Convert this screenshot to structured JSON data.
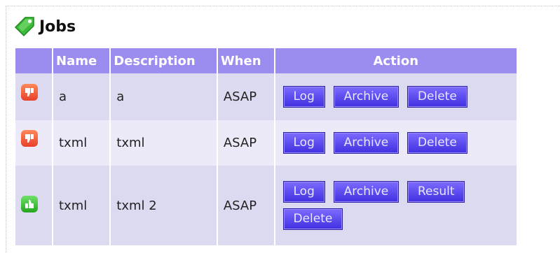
{
  "section": {
    "title": "Jobs"
  },
  "table": {
    "headers": {
      "name": "Name",
      "description": "Description",
      "when": "When",
      "action": "Action"
    },
    "rows": [
      {
        "status": "thumbs-down-icon",
        "name": "a",
        "description": "a",
        "when": "ASAP",
        "buttons": {
          "log": "Log",
          "archive": "Archive",
          "delete": "Delete"
        }
      },
      {
        "status": "thumbs-down-icon",
        "name": "txml",
        "description": "txml",
        "when": "ASAP",
        "buttons": {
          "log": "Log",
          "archive": "Archive",
          "delete": "Delete"
        }
      },
      {
        "status": "thumbs-up-icon",
        "name": "txml",
        "description": "txml 2",
        "when": "ASAP",
        "buttons": {
          "log": "Log",
          "archive": "Archive",
          "result": "Result",
          "delete": "Delete"
        }
      }
    ]
  },
  "colors": {
    "header_bg": "#9b8cf0",
    "row_odd": "#dcdaf0",
    "row_even": "#eceaf8",
    "button": "#5a48f0",
    "failed": "#e8402a",
    "success": "#23a51e"
  }
}
